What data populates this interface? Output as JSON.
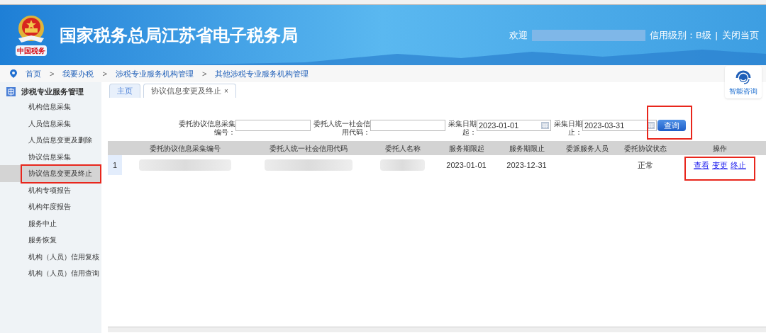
{
  "header": {
    "title": "国家税务总局江苏省电子税务局",
    "emblem_caption": "中国税务",
    "welcome": "欢迎",
    "credit": "信用级别：B级",
    "separator": "|",
    "close_link": "关闭当页"
  },
  "breadcrumbs": [
    "首页",
    ">",
    "我要办税",
    ">",
    "涉税专业服务机构管理",
    ">",
    "其他涉税专业服务机构管理"
  ],
  "help_widget": {
    "label": "智能咨询"
  },
  "sidebar": {
    "title": "涉税专业服务管理",
    "items": [
      {
        "label": "机构信息采集",
        "selected": false,
        "highlighted": false
      },
      {
        "label": "人员信息采集",
        "selected": false,
        "highlighted": false
      },
      {
        "label": "人员信息变更及删除",
        "selected": false,
        "highlighted": false
      },
      {
        "label": "协议信息采集",
        "selected": false,
        "highlighted": false
      },
      {
        "label": "协议信息变更及终止",
        "selected": true,
        "highlighted": true
      },
      {
        "label": "机构专项报告",
        "selected": false,
        "highlighted": false
      },
      {
        "label": "机构年度报告",
        "selected": false,
        "highlighted": false
      },
      {
        "label": "服务中止",
        "selected": false,
        "highlighted": false
      },
      {
        "label": "服务恢复",
        "selected": false,
        "highlighted": false
      },
      {
        "label": "机构（人员）信用复核",
        "selected": false,
        "highlighted": false
      },
      {
        "label": "机构（人员）信用查询",
        "selected": false,
        "highlighted": false
      }
    ]
  },
  "tabs": [
    {
      "label": "主页",
      "selected": false
    },
    {
      "label": "协议信息变更及终止",
      "selected": true,
      "close": "×"
    }
  ],
  "filters": [
    {
      "kind": "text",
      "label": "委托协议信息采集编号："
    },
    {
      "kind": "text",
      "label": "委托人统一社会信用代码："
    },
    {
      "kind": "date",
      "label": "采集日期起：",
      "value": "2023-01-01"
    },
    {
      "kind": "date",
      "label": "采集日期止：",
      "value": "2023-03-31"
    }
  ],
  "search_button": {
    "label": "查询",
    "highlighted": true
  },
  "table": {
    "columns": [
      "",
      "委托协议信息采集编号",
      "委托人统一社会信用代码",
      "委托人名称",
      "服务期限起",
      "服务期限止",
      "委派服务人员",
      "委托协议状态",
      "操作"
    ],
    "rows": [
      {
        "cells": [
          {
            "kind": "index",
            "text": "1"
          },
          {
            "kind": "redacted"
          },
          {
            "kind": "redacted"
          },
          {
            "kind": "redacted"
          },
          {
            "kind": "text",
            "text": "2023-01-01"
          },
          {
            "kind": "text",
            "text": "2023-12-31"
          },
          {
            "kind": "text"
          },
          {
            "kind": "text",
            "text": "正常"
          },
          {
            "kind": "links",
            "links": [
              "查看",
              "变更",
              "终止"
            ],
            "highlighted": true
          }
        ]
      }
    ]
  }
}
